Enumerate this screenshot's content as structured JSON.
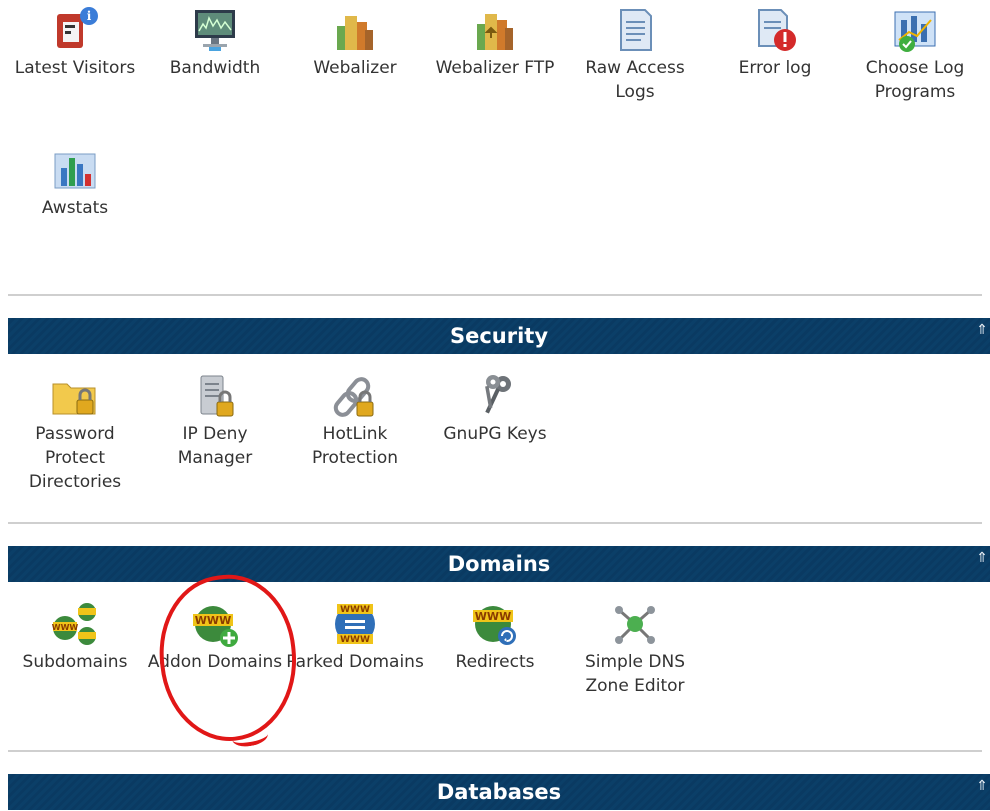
{
  "logs": {
    "items": [
      {
        "label": "Latest Visitors",
        "icon": "visitors-icon"
      },
      {
        "label": "Bandwidth",
        "icon": "bandwidth-icon"
      },
      {
        "label": "Webalizer",
        "icon": "webalizer-icon"
      },
      {
        "label": "Webalizer FTP",
        "icon": "webalizer-ftp-icon"
      },
      {
        "label": "Raw Access Logs",
        "icon": "raw-logs-icon"
      },
      {
        "label": "Error log",
        "icon": "error-log-icon"
      },
      {
        "label": "Choose Log Programs",
        "icon": "log-programs-icon"
      },
      {
        "label": "Awstats",
        "icon": "awstats-icon"
      }
    ]
  },
  "security": {
    "title": "Security",
    "collapse_glyph": "⇑",
    "items": [
      {
        "label": "Password Protect Directories",
        "icon": "folder-lock-icon"
      },
      {
        "label": "IP Deny Manager",
        "icon": "server-lock-icon"
      },
      {
        "label": "HotLink Protection",
        "icon": "chain-lock-icon"
      },
      {
        "label": "GnuPG Keys",
        "icon": "keys-icon"
      }
    ]
  },
  "domains": {
    "title": "Domains",
    "collapse_glyph": "⇑",
    "items": [
      {
        "label": "Subdomains",
        "icon": "subdomains-icon"
      },
      {
        "label": "Addon Domains",
        "icon": "addon-domains-icon"
      },
      {
        "label": "Parked Domains",
        "icon": "parked-domains-icon"
      },
      {
        "label": "Redirects",
        "icon": "redirects-icon"
      },
      {
        "label": "Simple DNS Zone Editor",
        "icon": "dns-editor-icon"
      }
    ]
  },
  "databases": {
    "title": "Databases",
    "collapse_glyph": "⇑"
  },
  "colors": {
    "section_bar": "#0b3f68",
    "highlight": "#e11717"
  }
}
